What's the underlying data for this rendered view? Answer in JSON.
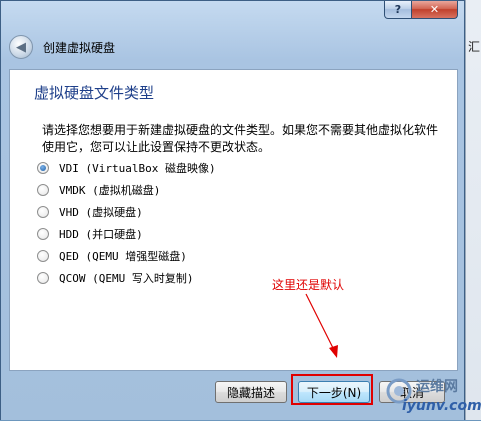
{
  "window": {
    "help_label": "?",
    "close_label": "✕"
  },
  "header": {
    "title": "创建虚拟硬盘"
  },
  "content": {
    "title": "虚拟硬盘文件类型",
    "description": "请选择您想要用于新建虚拟硬盘的文件类型。如果您不需要其他虚拟化软件使用它，您可以让此设置保持不更改状态。",
    "options": [
      {
        "label": "VDI (VirtualBox 磁盘映像)",
        "checked": true
      },
      {
        "label": "VMDK (虚拟机磁盘)",
        "checked": false
      },
      {
        "label": "VHD (虚拟硬盘)",
        "checked": false
      },
      {
        "label": "HDD (并口硬盘)",
        "checked": false
      },
      {
        "label": "QED (QEMU 增强型磁盘)",
        "checked": false
      },
      {
        "label": "QCOW (QEMU 写入时复制)",
        "checked": false
      }
    ]
  },
  "annotation": {
    "text": "这里还是默认"
  },
  "footer": {
    "hide_description_label": "隐藏描述",
    "next_label": "下一步(N)",
    "cancel_label": "取消"
  },
  "side_fragment": "汇",
  "watermark": {
    "top": "运维网",
    "bottom": "iyunv.com"
  },
  "colors": {
    "title_blue": "#1e3f8a",
    "annotation_red": "#e00000"
  }
}
